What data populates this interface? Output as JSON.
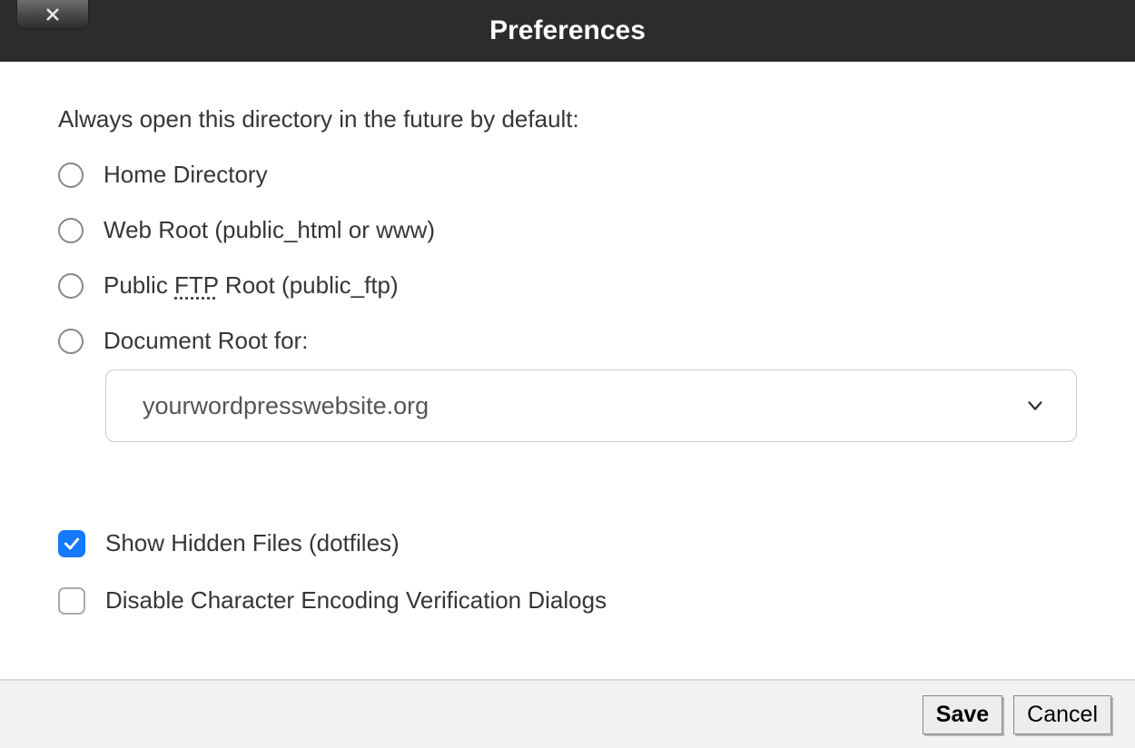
{
  "header": {
    "title": "Preferences"
  },
  "prompt": "Always open this directory in the future by default:",
  "radios": {
    "home": {
      "label": "Home Directory",
      "checked": false
    },
    "webroot": {
      "label_before": "Web Root (public_html or www)",
      "checked": false
    },
    "ftp": {
      "label_before": "Public ",
      "abbr": "FTP",
      "label_after": " Root (public_ftp)",
      "checked": false
    },
    "docroot": {
      "label": "Document Root for:",
      "checked": false
    }
  },
  "select": {
    "value": "yourwordpresswebsite.org"
  },
  "checkboxes": {
    "hidden": {
      "label": "Show Hidden Files (dotfiles)",
      "checked": true
    },
    "encoding": {
      "label": "Disable Character Encoding Verification Dialogs",
      "checked": false
    }
  },
  "footer": {
    "save": "Save",
    "cancel": "Cancel"
  }
}
